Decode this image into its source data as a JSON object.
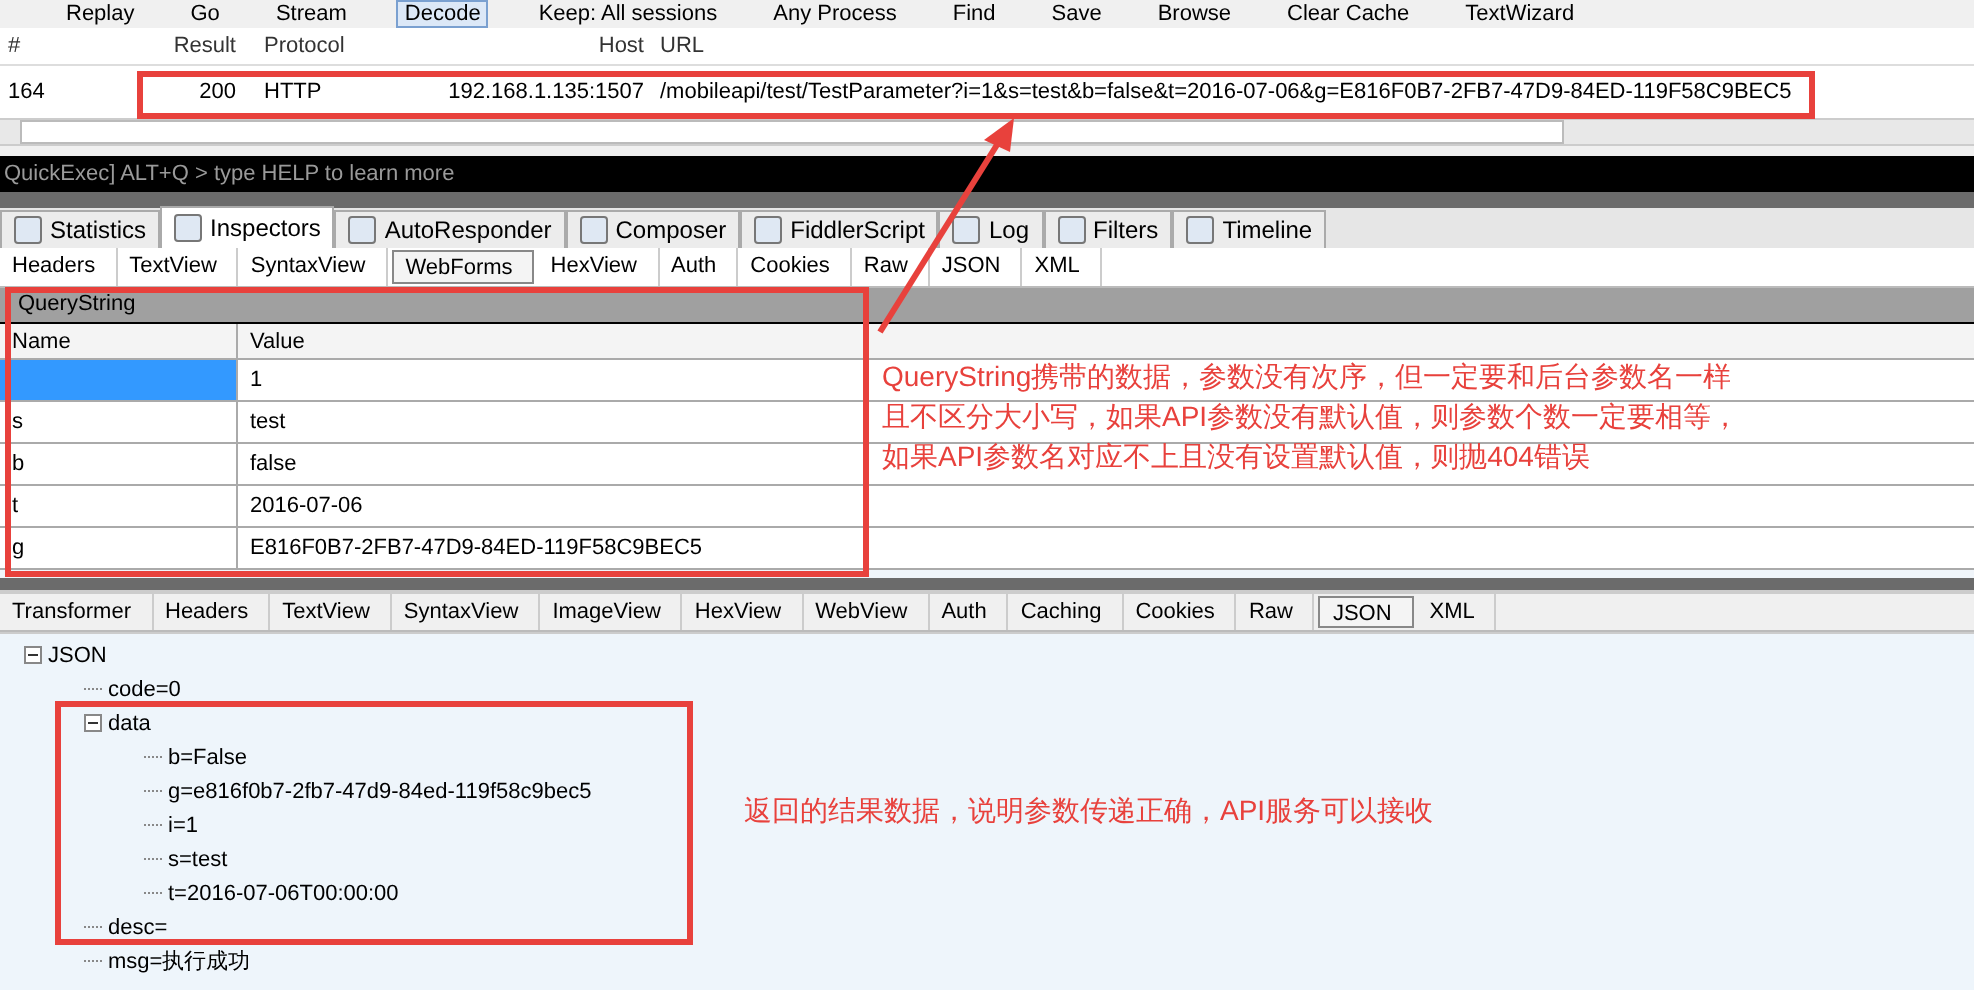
{
  "toolbar": [
    {
      "label": "Replay",
      "selected": false
    },
    {
      "label": "Go",
      "selected": false
    },
    {
      "label": "Stream",
      "selected": false
    },
    {
      "label": "Decode",
      "selected": true
    },
    {
      "label": "Keep: All sessions",
      "selected": false
    },
    {
      "label": "Any Process",
      "selected": false
    },
    {
      "label": "Find",
      "selected": false
    },
    {
      "label": "Save",
      "selected": false
    },
    {
      "label": "Browse",
      "selected": false
    },
    {
      "label": "Clear Cache",
      "selected": false
    },
    {
      "label": "TextWizard",
      "selected": false
    }
  ],
  "sessions": {
    "columns": [
      "#",
      "Result",
      "Protocol",
      "Host",
      "URL"
    ],
    "rows": [
      {
        "id": "164",
        "result": "200",
        "protocol": "HTTP",
        "host": "192.168.1.135:1507",
        "url": "/mobileapi/test/TestParameter?i=1&s=test&b=false&t=2016-07-06&g=E816F0B7-2FB7-47D9-84ED-119F58C9BEC5"
      }
    ]
  },
  "quickexec": {
    "placeholder": "QuickExec] ALT+Q > type HELP to learn more"
  },
  "main_tabs": [
    {
      "label": "Statistics",
      "selected": false
    },
    {
      "label": "Inspectors",
      "selected": true
    },
    {
      "label": "AutoResponder",
      "selected": false
    },
    {
      "label": "Composer",
      "selected": false
    },
    {
      "label": "FiddlerScript",
      "selected": false
    },
    {
      "label": "Log",
      "selected": false
    },
    {
      "label": "Filters",
      "selected": false
    },
    {
      "label": "Timeline",
      "selected": false
    }
  ],
  "request_tabs": [
    {
      "label": "Headers",
      "selected": false
    },
    {
      "label": "TextView",
      "selected": false
    },
    {
      "label": "SyntaxView",
      "selected": false
    },
    {
      "label": "WebForms",
      "selected": true
    },
    {
      "label": "HexView",
      "selected": false
    },
    {
      "label": "Auth",
      "selected": false
    },
    {
      "label": "Cookies",
      "selected": false
    },
    {
      "label": "Raw",
      "selected": false
    },
    {
      "label": "JSON",
      "selected": false
    },
    {
      "label": "XML",
      "selected": false
    }
  ],
  "querystring": {
    "title": "QueryString",
    "columns": [
      "Name",
      "Value"
    ],
    "rows": [
      {
        "value": "1",
        "selected": true
      },
      {
        "name": "s",
        "value": "test",
        "selected": false
      },
      {
        "name": "b",
        "value": "false",
        "selected": false
      },
      {
        "name": "t",
        "value": "2016-07-06",
        "selected": false
      },
      {
        "name": "g",
        "value": "E816F0B7-2FB7-47D9-84ED-119F58C9BEC5",
        "selected": false
      }
    ]
  },
  "request_note": [
    "QueryString携带的数据，参数没有次序，但一定要和后台参数名一样",
    "且不区分大小写，如果API参数没有默认值，则参数个数一定要相等，",
    "如果API参数名对应不上且没有设置默认值，则抛404错误"
  ],
  "response_tabs": [
    {
      "label": "Transformer",
      "selected": false
    },
    {
      "label": "Headers",
      "selected": false
    },
    {
      "label": "TextView",
      "selected": false
    },
    {
      "label": "SyntaxView",
      "selected": false
    },
    {
      "label": "ImageView",
      "selected": false
    },
    {
      "label": "HexView",
      "selected": false
    },
    {
      "label": "WebView",
      "selected": false
    },
    {
      "label": "Auth",
      "selected": false
    },
    {
      "label": "Caching",
      "selected": false
    },
    {
      "label": "Cookies",
      "selected": false
    },
    {
      "label": "Raw",
      "selected": false
    },
    {
      "label": "JSON",
      "selected": true
    },
    {
      "label": "XML",
      "selected": false
    }
  ],
  "json_tree": [
    {
      "label": "JSON",
      "expanded": true,
      "children": [
        {
          "label": "code=0"
        },
        {
          "label": "data",
          "expanded": true,
          "children": [
            {
              "label": "b=False"
            },
            {
              "label": "g=e816f0b7-2fb7-47d9-84ed-119f58c9bec5"
            },
            {
              "label": "i=1"
            },
            {
              "label": "s=test"
            },
            {
              "label": "t=2016-07-06T00:00:00"
            }
          ]
        },
        {
          "label": "desc="
        },
        {
          "label": "msg=执行成功"
        }
      ]
    }
  ],
  "response_note": "返回的结果数据，说明参数传递正确，API服务可以接收"
}
